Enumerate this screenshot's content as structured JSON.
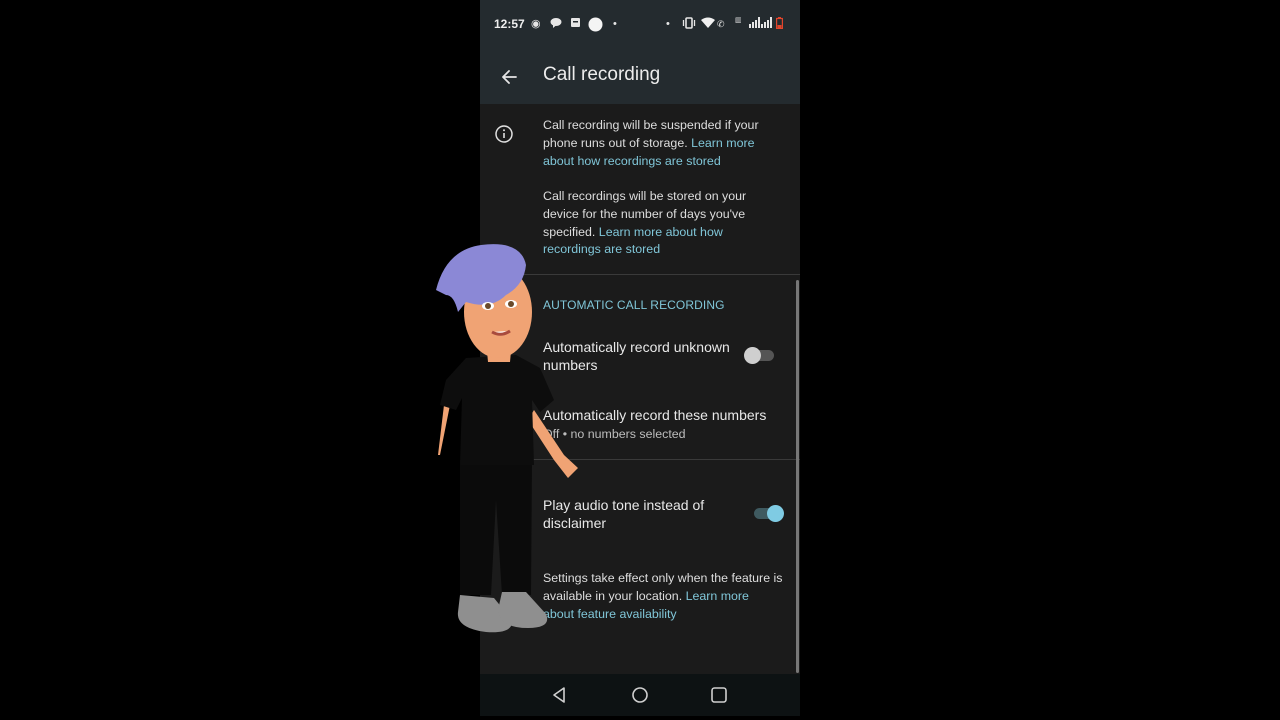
{
  "status_bar": {
    "time": "12:57",
    "left_icons": [
      "screen-record-icon",
      "chat-bubble-icon",
      "calendar-icon",
      "circle-dot-icon",
      "small-dot-icon"
    ],
    "right_icons": [
      "small-dot-icon",
      "vibrate-icon",
      "wifi-icon",
      "wifi-calling-icon",
      "volte-icon",
      "signal-icon",
      "signal-icon",
      "battery-low-icon"
    ],
    "battery_color": "#e0452c"
  },
  "app_bar": {
    "back_label": "Back",
    "title": "Call recording"
  },
  "info": {
    "para1_text": "Call recording will be suspended if your phone runs out of storage. ",
    "para1_link": "Learn more about how recordings are stored",
    "para2_text": "Call recordings will be stored on your device for the number of days you've specified. ",
    "para2_link": "Learn more about how recordings are stored"
  },
  "section_header": "AUTOMATIC CALL RECORDING",
  "settings": [
    {
      "title": "Automatically record unknown numbers",
      "toggle": false
    },
    {
      "title": "Automatically record these numbers",
      "subtitle": "Off • no numbers selected"
    },
    {
      "title": "Play audio tone instead of disclaimer",
      "toggle": true
    }
  ],
  "footer": {
    "text": "Settings take effect only when the feature is available in your location. ",
    "link": "Learn more about feature availability"
  },
  "nav_bar": {
    "back": "back-triangle-icon",
    "home": "home-circle-icon",
    "recents": "recents-square-icon"
  },
  "colors": {
    "accent": "#80c6d8",
    "header_bg": "#242b2f",
    "content_bg": "#1b1b1b",
    "toggle_on": "#7fcbe3"
  }
}
